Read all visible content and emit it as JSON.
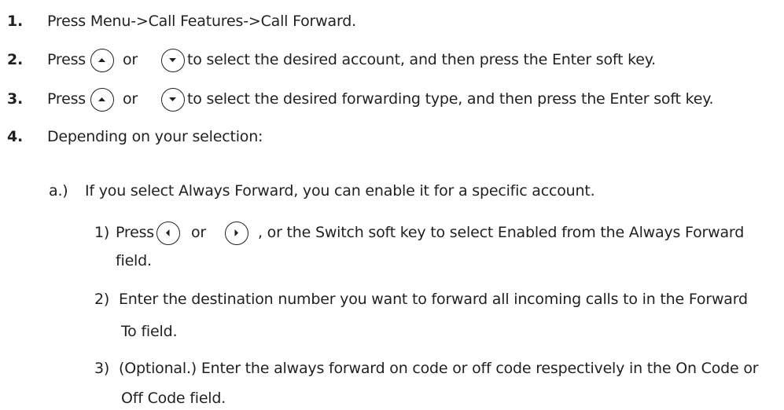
{
  "steps": [
    {
      "num": "1.",
      "text": "Press Menu->Call Features->Call Forward."
    },
    {
      "num": "2.",
      "pre": "Press",
      "mid": "or",
      "post": "to select the desired account, and then press the Enter soft key."
    },
    {
      "num": "3.",
      "pre": "Press",
      "mid": "or",
      "post": "to select the desired forwarding type, and then press the Enter soft key."
    },
    {
      "num": "4.",
      "text": "Depending on your selection:"
    }
  ],
  "sub": {
    "label": "a.)",
    "text": "If you select Always Forward, you can enable it for a specific account.",
    "items": [
      {
        "num": "1)",
        "pre": "Press",
        "mid": "or",
        "post": ", or the Switch soft key to select Enabled from the Always Forward",
        "cont": "field."
      },
      {
        "num": "2)",
        "text": "Enter the destination number you want to forward all incoming calls to in the Forward",
        "cont": "To field."
      },
      {
        "num": "3)",
        "text": "(Optional.) Enter the always forward on code or off code respectively in the On Code or",
        "cont": "Off Code field."
      }
    ]
  },
  "icons": {
    "up": "up-arrow-key-icon",
    "down": "down-arrow-key-icon",
    "left": "left-arrow-key-icon",
    "right": "right-arrow-key-icon"
  }
}
